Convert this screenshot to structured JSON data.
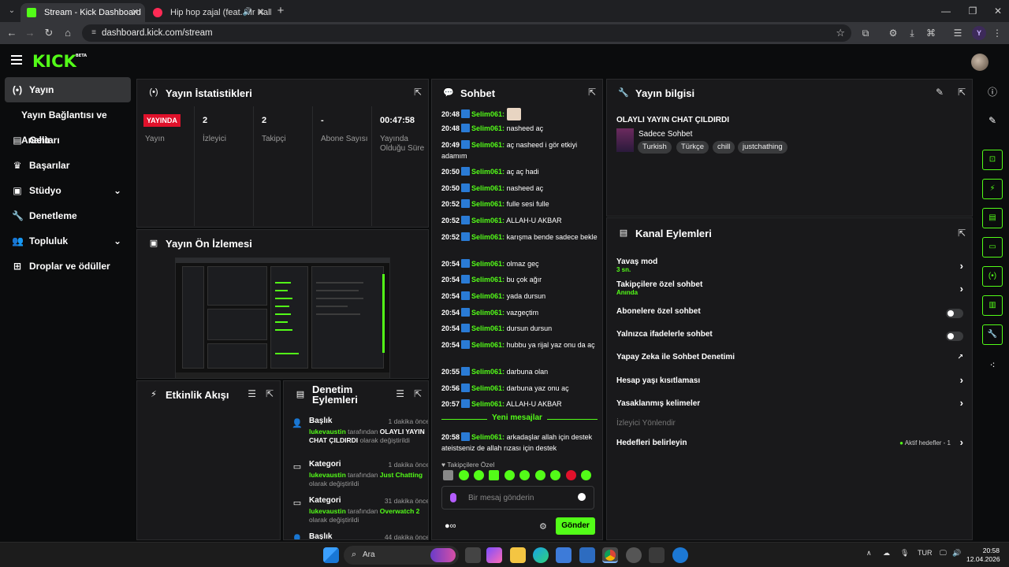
{
  "browser": {
    "tabs": [
      {
        "title": "Stream - Kick Dashboard",
        "active": true
      },
      {
        "title": "Hip hop zajal (feat. Mr Kalla",
        "active": false
      }
    ],
    "url": "dashboard.kick.com/stream",
    "profile_initial": "Y"
  },
  "app": {
    "logo": "KICK",
    "logo_badge": "BETA",
    "colors": {
      "accent": "#53fc18",
      "live": "#e0112b",
      "panel": "#19191b"
    }
  },
  "sidebar": {
    "items": [
      {
        "label": "Yayın",
        "icon": "broadcast-icon"
      },
      {
        "label": "Yayın Bağlantısı ve Anahtarı"
      },
      {
        "label": "Gelir",
        "icon": "revenue-icon"
      },
      {
        "label": "Başarılar",
        "icon": "trophy-icon"
      },
      {
        "label": "Stüdyo",
        "icon": "studio-icon"
      },
      {
        "label": "Denetleme",
        "icon": "wrench-icon"
      },
      {
        "label": "Topluluk",
        "icon": "community-icon"
      },
      {
        "label": "Droplar ve ödüller",
        "icon": "drops-icon"
      }
    ]
  },
  "stats": {
    "title": "Yayın İstatistikleri",
    "live_badge": "YAYINDA",
    "live_label": "Yayın",
    "columns": [
      {
        "value": "2",
        "label": "İzleyici"
      },
      {
        "value": "2",
        "label": "Takipçi"
      },
      {
        "value": "-",
        "label": "Abone Sayısı"
      },
      {
        "value": "00:47:58",
        "label": "Yayında Olduğu Süre"
      }
    ]
  },
  "preview": {
    "title": "Yayın Ön İzlemesi"
  },
  "activity": {
    "title": "Etkinlik Akışı"
  },
  "mod_actions": {
    "title": "Denetim Eylemleri",
    "items": [
      {
        "title": "Başlık",
        "time": "1 dakika önce",
        "user": "lukevaustin",
        "mid": " tarafından ",
        "value": "OLAYLI YAYIN CHAT ÇILDIRDI",
        "tail": " olarak değiştirildi"
      },
      {
        "title": "Kategori",
        "time": "1 dakika önce",
        "user": "lukevaustin",
        "mid": " tarafından ",
        "value": "Just Chatting",
        "tail": " olarak değiştirildi"
      },
      {
        "title": "Kategori",
        "time": "31 dakika önce",
        "user": "lukevaustin",
        "mid": " tarafından ",
        "value": "Overwatch 2",
        "tail": " olarak değiştirildi"
      },
      {
        "title": "Başlık",
        "time": "44 dakika önce"
      }
    ]
  },
  "chat": {
    "title": "Sohbet",
    "messages": [
      {
        "time": "20:48",
        "user": "Selim061:",
        "text": ""
      },
      {
        "time": "20:48",
        "user": "Selim061:",
        "text": "nasheed aç"
      },
      {
        "time": "20:49",
        "user": "Selim061:",
        "text": "aç nasheed i gör etkiyi adamım"
      },
      {
        "time": "20:50",
        "user": "Selim061:",
        "text": "aç aç hadi"
      },
      {
        "time": "20:50",
        "user": "Selim061:",
        "text": "nasheed aç"
      },
      {
        "time": "20:52",
        "user": "Selim061:",
        "text": "fulle sesi fulle"
      },
      {
        "time": "20:52",
        "user": "Selim061:",
        "text": "ALLAH-U AKBAR"
      },
      {
        "time": "20:52",
        "user": "Selim061:",
        "text": "karışma bende sadece bekle"
      },
      {
        "time": "20:54",
        "user": "Selim061:",
        "text": "olmaz geç"
      },
      {
        "time": "20:54",
        "user": "Selim061:",
        "text": "bu çok ağır"
      },
      {
        "time": "20:54",
        "user": "Selim061:",
        "text": "yada dursun"
      },
      {
        "time": "20:54",
        "user": "Selim061:",
        "text": "vazgeçtim"
      },
      {
        "time": "20:54",
        "user": "Selim061:",
        "text": "dursun dursun"
      },
      {
        "time": "20:54",
        "user": "Selim061:",
        "text": "hubbu ya rijal yaz onu da aç"
      },
      {
        "time": "20:55",
        "user": "Selim061:",
        "text": "darbuna olan"
      },
      {
        "time": "20:56",
        "user": "Selim061:",
        "text": "darbuna yaz onu aç"
      },
      {
        "time": "20:57",
        "user": "Selim061:",
        "text": "ALLAH-U AKBAR"
      }
    ],
    "new_messages_label": "Yeni mesajlar",
    "new_message": {
      "time": "20:58",
      "user": "Selim061:",
      "text": "arkadaşlar allah için destek ateistseniz de allah rızası için destek"
    },
    "followers_only_label": "Takipçilere Özel",
    "input_placeholder": "Bir mesaj gönderin",
    "send_label": "Gönder"
  },
  "stream_info": {
    "title": "Yayın bilgisi",
    "stream_title": "OLAYLI YAYIN CHAT ÇILDIRDI",
    "category": "Sadece Sohbet",
    "tags": [
      "Turkish",
      "Türkçe",
      "chill",
      "justchathing"
    ]
  },
  "channel_actions": {
    "title": "Kanal Eylemleri",
    "rows": [
      {
        "label": "Yavaş mod",
        "sub": "3 sn.",
        "control": "chevron"
      },
      {
        "label": "Takipçilere özel sohbet",
        "sub": "Anında",
        "control": "chevron"
      },
      {
        "label": "Abonelere özel sohbet",
        "control": "toggle"
      },
      {
        "label": "Yalnızca ifadelerle sohbet",
        "control": "toggle"
      },
      {
        "label": "Yapay Zeka ile Sohbet Denetimi",
        "control": "external"
      },
      {
        "label": "Hesap yaşı kısıtlaması",
        "control": "chevron"
      },
      {
        "label": "Yasaklanmış kelimeler",
        "control": "chevron"
      },
      {
        "label": "İzleyici Yönlendir",
        "control": "none"
      },
      {
        "label": "Hedefleri belirleyin",
        "status": "Aktif hedefler - 1",
        "control": "chevron"
      }
    ]
  },
  "taskbar": {
    "search_label": "Ara",
    "lang": "TUR",
    "time": "20:58",
    "date": "12.04.2026"
  }
}
